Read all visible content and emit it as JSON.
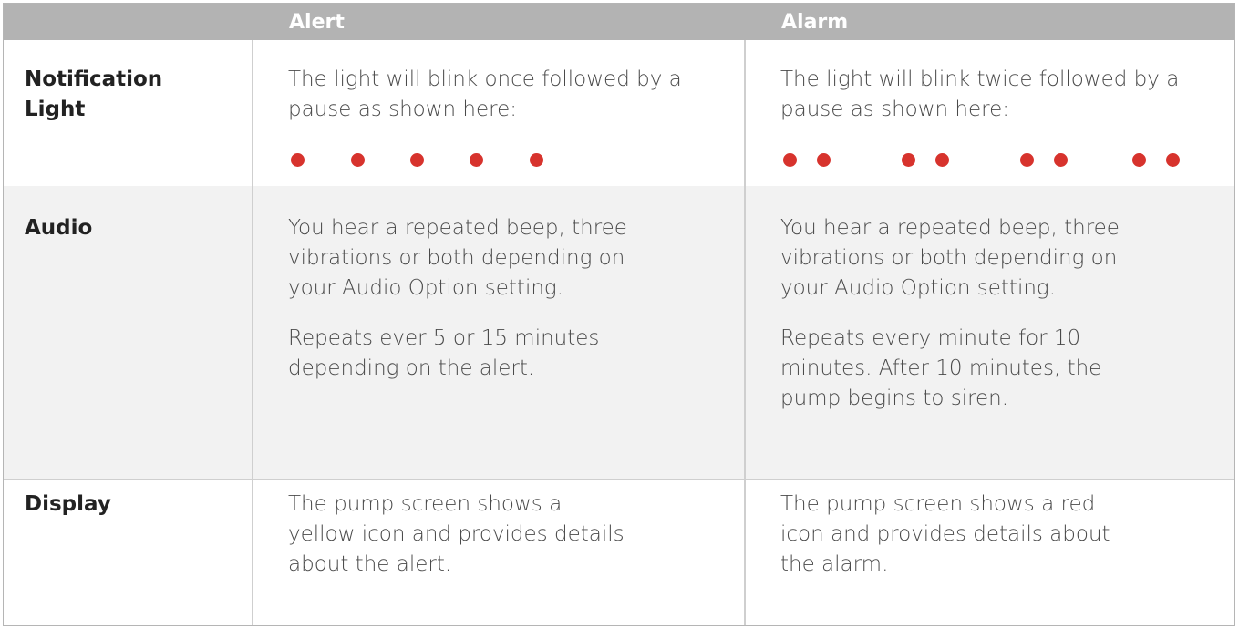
{
  "header": {
    "alert": "Alert",
    "alarm": "Alarm"
  },
  "rows": {
    "notification": {
      "label": "Notification Light",
      "alert": "The light will blink once followed by a pause as shown here:",
      "alarm": "The light will blink twice followed by a pause as shown here:"
    },
    "audio": {
      "label": "Audio",
      "alert_p1": "You hear a repeated beep, three vibrations or both depending on your Audio Option setting.",
      "alert_p2": "Repeats ever 5 or 15 minutes depending on the alert.",
      "alarm_p1": "You hear a repeated beep, three vibrations or both depending on your Audio Option setting.",
      "alarm_p2": "Repeats every minute for 10 minutes. After 10 minutes, the pump begins to siren."
    },
    "display": {
      "label": "Display",
      "alert": "The pump screen shows a yellow icon and provides details about the alert.",
      "alarm": "The pump screen shows a red icon and provides details about the alarm."
    }
  },
  "colors": {
    "header_bg": "#b3b3b3",
    "dot_red": "#d7332d",
    "audio_row_bg": "#f2f2f2"
  }
}
